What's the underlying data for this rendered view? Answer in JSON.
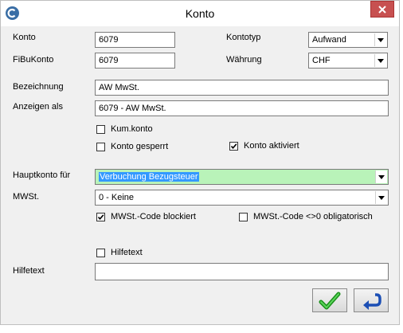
{
  "window": {
    "title": "Konto",
    "app_icon": "app-logo-icon",
    "close_icon": "close-icon"
  },
  "form": {
    "konto_label": "Konto",
    "konto_value": "6079",
    "fibukonto_label": "FiBuKonto",
    "fibukonto_value": "6079",
    "kontotyp_label": "Kontotyp",
    "kontotyp_value": "Aufwand",
    "waehrung_label": "Währung",
    "waehrung_value": "CHF",
    "bezeichnung_label": "Bezeichnung",
    "bezeichnung_value": "AW MwSt.",
    "anzeigen_label": "Anzeigen als",
    "anzeigen_value": "6079 - AW MwSt.",
    "kumkonto_label": "Kum.konto",
    "kumkonto_checked": false,
    "gesperrt_label": "Konto gesperrt",
    "gesperrt_checked": false,
    "aktiviert_label": "Konto aktiviert",
    "aktiviert_checked": true,
    "hauptkonto_label": "Hauptkonto für",
    "hauptkonto_value": "Verbuchung Bezugsteuer",
    "hauptkonto_color": "#b9f3b9",
    "mwst_label": "MWSt.",
    "mwst_value": "0 - Keine",
    "mwst_blockiert_label": "MWSt.-Code blockiert",
    "mwst_blockiert_checked": true,
    "mwst_obligatorisch_label": "MWSt.-Code <>0 obligatorisch",
    "mwst_obligatorisch_checked": false,
    "hilfetext_cb_label": "Hilfetext",
    "hilfetext_cb_checked": false,
    "hilfetext_label": "Hilfetext",
    "hilfetext_value": ""
  },
  "buttons": {
    "ok_icon": "checkmark-icon",
    "back_icon": "return-arrow-icon"
  }
}
